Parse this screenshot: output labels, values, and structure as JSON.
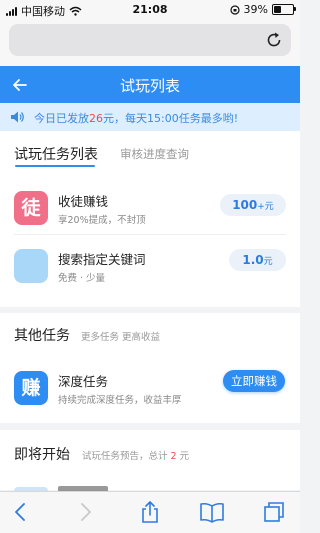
{
  "status": {
    "carrier": "中国移动",
    "time": "21:08",
    "battery": "39%",
    "battery_level": 0.39
  },
  "header": {
    "title": "试玩列表",
    "accent": "#2e8df2"
  },
  "notice": {
    "prefix": "今日已发放",
    "amount": "26",
    "suffix": "元，每天15:00任务最多哟!"
  },
  "tabs": [
    {
      "label": "试玩任务列表",
      "active": true
    },
    {
      "label": "审核进度查询",
      "active": false
    }
  ],
  "trial_tasks": [
    {
      "icon_char": "徒",
      "icon_color": "#f0708a",
      "title": "收徒赚钱",
      "subtitle": "享20%提成，不封顶",
      "reward": "100",
      "unit": "+元"
    },
    {
      "icon_char": "",
      "icon_color": "#a9d7f7",
      "title": "搜索指定关键词",
      "subtitle": "免费 · 少量",
      "reward": "1.0",
      "unit": "元"
    }
  ],
  "other_tasks": {
    "title": "其他任务",
    "subtitle": "更多任务 更高收益",
    "item": {
      "icon_char": "赚",
      "icon_color": "#2e8df2",
      "title": "深度任务",
      "subtitle": "持续完成深度任务，收益丰厚",
      "button": "立即赚钱"
    }
  },
  "upcoming": {
    "title": "即将开始",
    "subtitle_prefix": "试玩任务预告，总计",
    "amount": "2",
    "subtitle_suffix": "元"
  },
  "toolbar_icons": [
    "back-arrow-icon",
    "forward-arrow-icon",
    "share-icon",
    "bookmarks-icon",
    "tabs-icon"
  ]
}
